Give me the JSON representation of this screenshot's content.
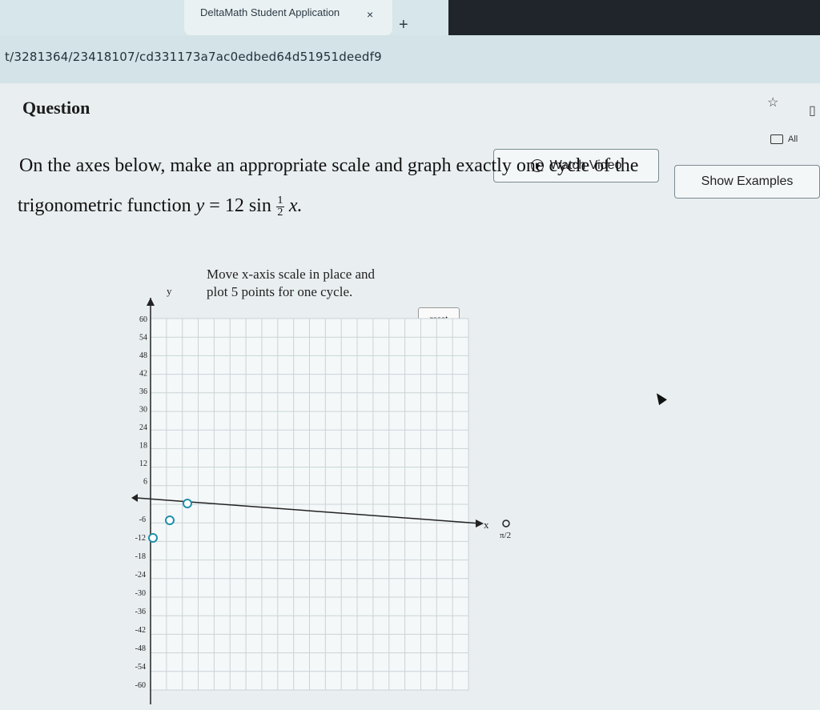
{
  "browser": {
    "tab_title": "DeltaMath Student Application",
    "tab_close": "×",
    "new_tab": "+",
    "url": "t/3281364/23418107/cd331173a7ac0edbed64d51951deedf9",
    "all_bookmarks": "All"
  },
  "page": {
    "title": "Question",
    "watch_video_label": "Watch Video",
    "show_examples_label": "Show Examples"
  },
  "question": {
    "line1": "On the axes below, make an appropriate scale and graph exactly one cycle of the",
    "line2": "trigonometric function",
    "function_y": "y",
    "function_eq": "=",
    "function_rhs": "12 sin",
    "function_frac_num": "1",
    "function_frac_den": "2",
    "function_x": "x."
  },
  "graph": {
    "instructions_line1": "Move x-axis scale in place and",
    "instructions_line2": "plot 5 points for one cycle.",
    "reset_label": "reset",
    "y_axis_label": "y",
    "x_axis_label": "x",
    "x_scale_handle_label": "π/2",
    "y_ticks_pos": [
      "60",
      "54",
      "48",
      "42",
      "36",
      "30",
      "24",
      "18",
      "12",
      "6"
    ],
    "y_ticks_neg": [
      "-6",
      "-12",
      "-18",
      "-24",
      "-30",
      "-36",
      "-42",
      "-48",
      "-54",
      "-60"
    ]
  }
}
